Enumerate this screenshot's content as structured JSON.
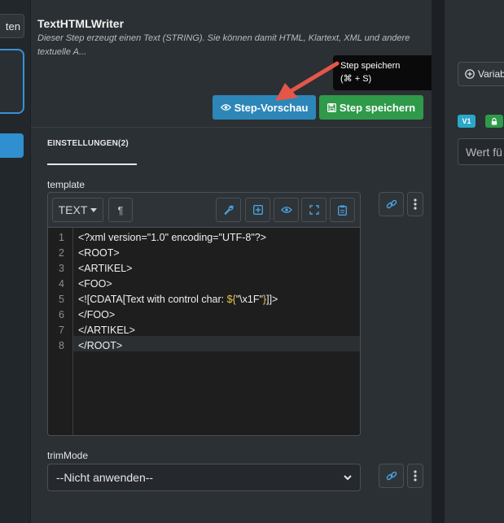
{
  "left_strip": {
    "top_button_label": "ten"
  },
  "header": {
    "title": "TextHTMLWriter",
    "description": "Dieser Step erzeugt einen Text (STRING). Sie können damit HTML, Klartext, XML und andere textuelle A..."
  },
  "tooltip": {
    "line1": "Step speichern",
    "line2": "(⌘ + S)"
  },
  "actions": {
    "preview_label": "Step-Vorschau",
    "save_label": "Step speichern"
  },
  "tabs": {
    "settings_label": "EINSTELLUNGEN(2)"
  },
  "template": {
    "label": "template",
    "mode_label": "TEXT",
    "lines": [
      {
        "n": "1",
        "text": "<?xml version=\"1.0\" encoding=\"UTF-8\"?>"
      },
      {
        "n": "2",
        "text": "<ROOT>"
      },
      {
        "n": "3",
        "text": "<ARTIKEL>"
      },
      {
        "n": "4",
        "text": "<FOO>"
      },
      {
        "n": "5",
        "pre": "<![CDATA[Text with control char: ",
        "tok_open": "${",
        "str": "\"\\x1F\"",
        "tok_close": "}",
        "post": "]]>"
      },
      {
        "n": "6",
        "text": "</FOO>"
      },
      {
        "n": "7",
        "text": "</ARTIKEL>"
      },
      {
        "n": "8",
        "text": "</ROOT>"
      }
    ]
  },
  "trim_mode": {
    "label": "trimMode",
    "selected": "--Nicht anwenden--"
  },
  "right_panel": {
    "variables_label": "Variab",
    "version_badge": "V1",
    "value_placeholder": "Wert fü"
  },
  "colors": {
    "preview_button": "#2d86b8",
    "save_button": "#2f9a4a",
    "accent_icon": "#4aa3e0",
    "arrow": "#e5564a",
    "badge_v1": "#2aa7c9"
  }
}
